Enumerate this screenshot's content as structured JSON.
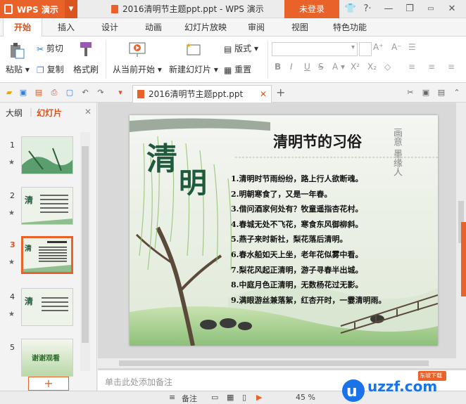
{
  "app": {
    "name": "WPS 演示",
    "document_title": "2016清明节主题ppt.ppt - WPS 演示",
    "login_label": "未登录"
  },
  "ribbon_tabs": [
    "开始",
    "插入",
    "设计",
    "动画",
    "幻灯片放映",
    "审阅",
    "视图",
    "特色功能"
  ],
  "ribbon": {
    "paste": "粘贴",
    "cut": "剪切",
    "copy": "复制",
    "format_painter": "格式刷",
    "from_current": "从当前开始",
    "new_slide": "新建幻灯片",
    "layout": "版式",
    "reset": "重置"
  },
  "doc_tab": {
    "label": "2016清明节主题ppt.ppt"
  },
  "left_panel": {
    "tab_outline": "大纲",
    "tab_slides": "幻灯片",
    "thumbnails": [
      {
        "num": "1"
      },
      {
        "num": "2"
      },
      {
        "num": "3"
      },
      {
        "num": "4"
      },
      {
        "num": "5",
        "caption": "谢谢观看"
      }
    ],
    "active_index": 3
  },
  "slide": {
    "title": "清明节的习俗",
    "big_char_1": "清",
    "big_char_2": "明",
    "side_calligraphy": "画意 墨缘人",
    "poem": [
      "1.清明时节雨纷纷，路上行人欲断魂。",
      "2.明朝寒食了，又是一年春。",
      "3.借问酒家何处有？牧童遥指杏花村。",
      "4.春城无处不飞花，寒食东风御柳斜。",
      "5.燕子来时新社，梨花落后清明。",
      "6.春水船如天上坐，老年花似雾中看。",
      "7.梨花风起正清明，游子寻春半出城。",
      "8.中庭月色正清明，无数杨花过无影。",
      "9.满眼游丝兼落絮，红杏开时，一霎清明雨。"
    ]
  },
  "notes_placeholder": "单击此处添加备注",
  "status": {
    "notes": "备注",
    "zoom": "45 %"
  },
  "watermark": {
    "text": "uzzf.com",
    "badge": "东坡下载"
  },
  "colors": {
    "accent": "#e8622a",
    "title_bar": "#ececec",
    "ink_green": "#1f5a3c"
  }
}
